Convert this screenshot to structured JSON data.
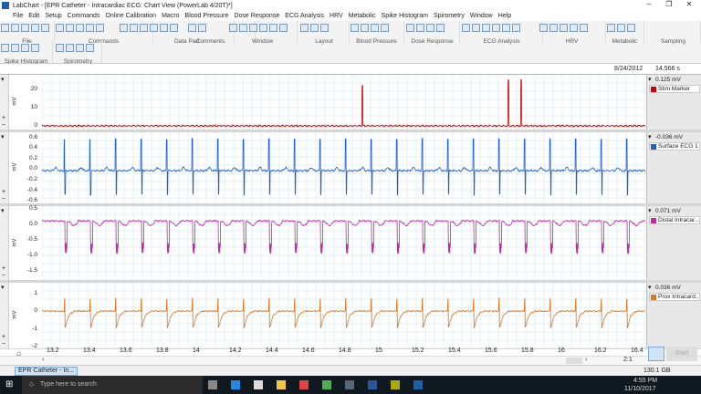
{
  "window": {
    "title": "LabChart - [EPR Catheter - Intracardiac ECG: Chart View (PowerLab 4/20T)*]"
  },
  "menu": [
    "File",
    "Edit",
    "Setup",
    "Commands",
    "Online Calibration",
    "Macro",
    "Blood Pressure",
    "Dose Response",
    "ECG Analysis",
    "HRV",
    "Metabolic",
    "Spike Histogram",
    "Spirometry",
    "Window",
    "Help"
  ],
  "ribbon": {
    "groups": [
      "File",
      "Commands",
      "Data Pad",
      "Comments",
      "Window",
      "Layout",
      "Blood Pressure",
      "Dose Response",
      "ECG Analysis",
      "HRV",
      "Metabolic",
      "Sampling"
    ],
    "groups2": [
      "Spike Histogram",
      "Spirometry"
    ],
    "start_label": "Start"
  },
  "status": {
    "date": "8/24/2012",
    "time": "14.566 s",
    "disk": "130.1 GB",
    "zoom": "2:1"
  },
  "channels": [
    {
      "name": "Stim Marker",
      "value": "0.125 mV",
      "unit": "mV",
      "color": "#cc0000",
      "ticks": [
        "20",
        "10",
        "0"
      ]
    },
    {
      "name": "Surface ECG 1",
      "value": "-0.036 mV",
      "unit": "mV",
      "color": "#1f5fcc",
      "ticks": [
        "0.6",
        "0.4",
        "0.2",
        "0.0",
        "-0.2",
        "-0.4",
        "-0.6"
      ]
    },
    {
      "name": "Distal Intracar...",
      "value": "0.071 mV",
      "unit": "mV",
      "color": "#c02aa8",
      "ticks": [
        "0.5",
        "0.0",
        "-0.5",
        "-1.0",
        "-1.5"
      ]
    },
    {
      "name": "Prox Intracard...",
      "value": "0.036 mV",
      "unit": "mV",
      "color": "#d9781e",
      "ticks": [
        "1",
        "0",
        "-1",
        "-2"
      ]
    }
  ],
  "time_axis": {
    "ticks": [
      "13.2",
      "13.4",
      "13.6",
      "13.8",
      "14",
      "14.2",
      "14.4",
      "14.6",
      "14.8",
      "15",
      "15.2",
      "15.4",
      "15.6",
      "15.8",
      "16",
      "16.2",
      "16.4"
    ],
    "range": [
      13.145,
      16.45
    ]
  },
  "signals": {
    "beat_period_s": 0.14,
    "first_beat_s": 13.27,
    "stim_times_s": [
      14.9,
      15.7,
      15.77
    ]
  },
  "doc_tab": "EPR Catheter - In...",
  "taskbar": {
    "search_placeholder": "Type here to search",
    "clock_time": "4:55 PM",
    "clock_date": "11/10/2017"
  }
}
